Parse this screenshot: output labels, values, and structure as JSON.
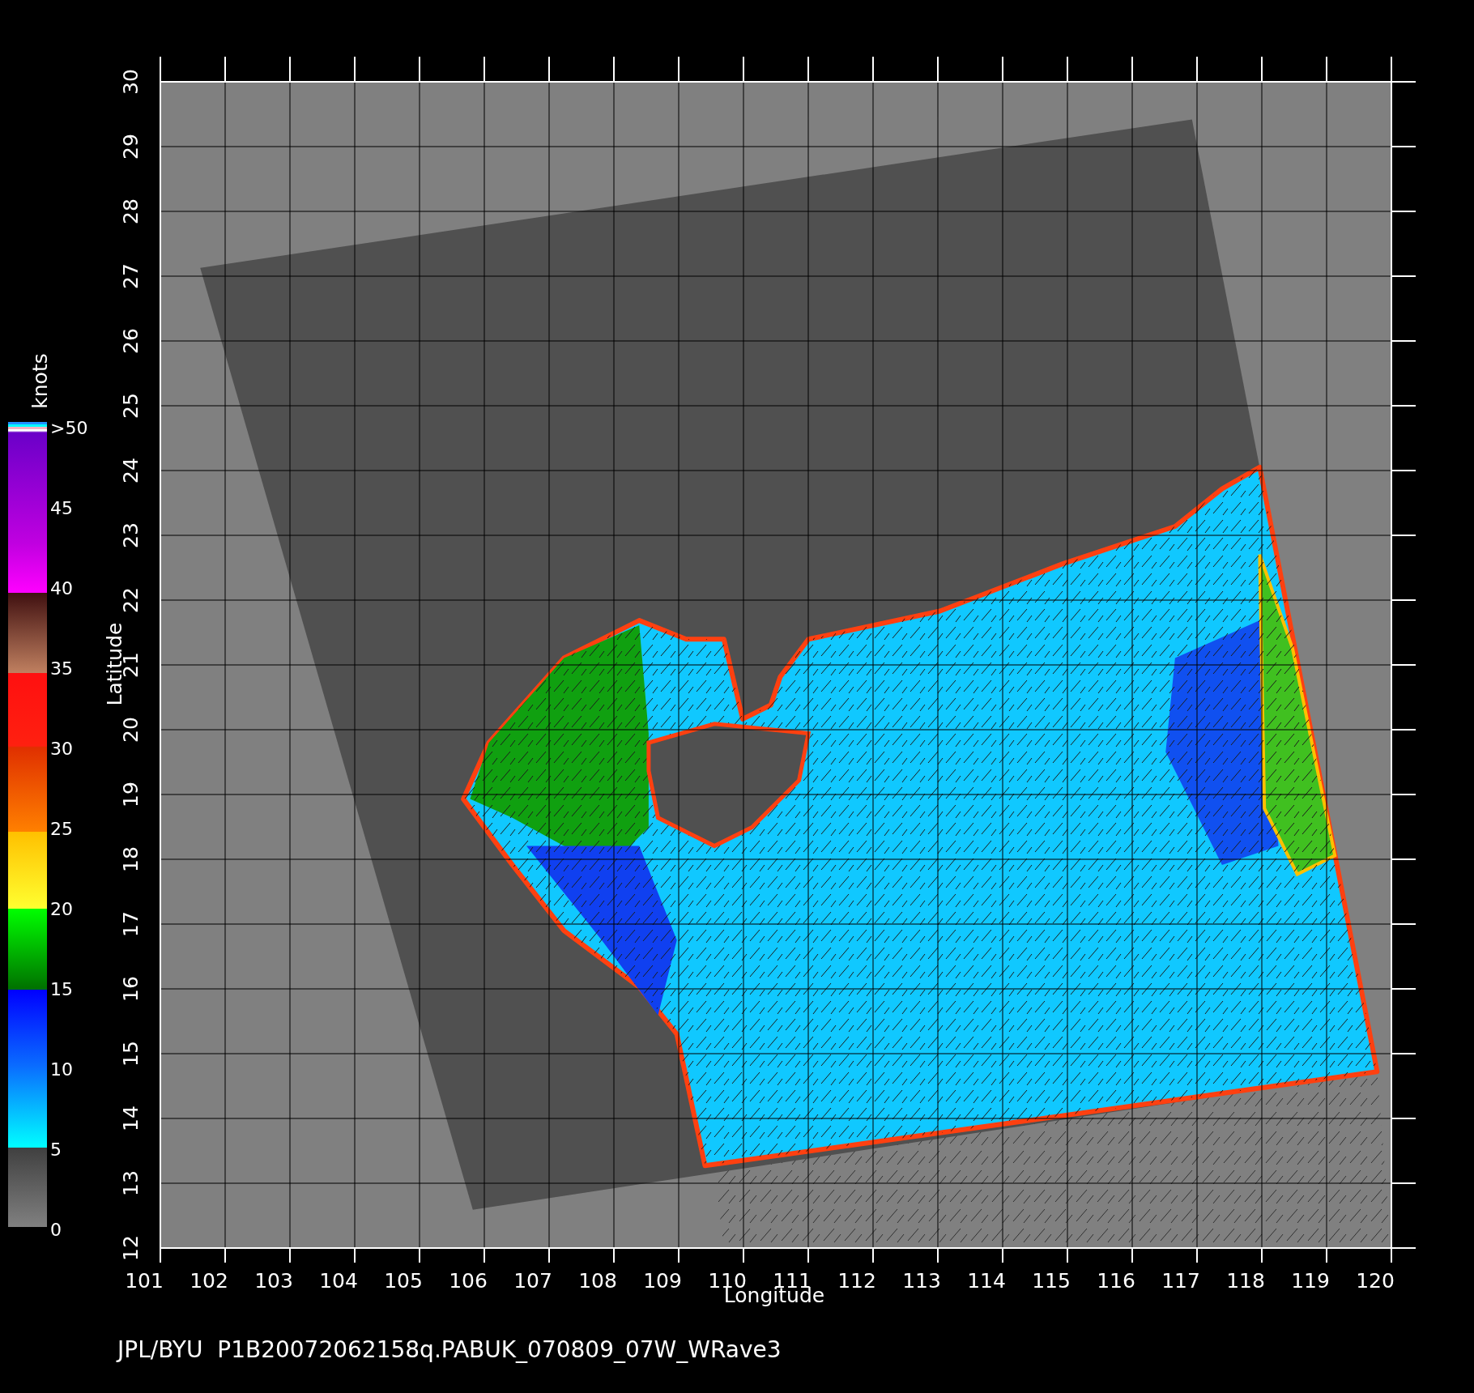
{
  "plot": {
    "x_axis": {
      "title": "Longitude",
      "tick_labels": [
        "101",
        "102",
        "103",
        "104",
        "105",
        "106",
        "107",
        "108",
        "109",
        "110",
        "111",
        "112",
        "113",
        "114",
        "115",
        "116",
        "117",
        "118",
        "119",
        "120"
      ]
    },
    "y_axis": {
      "title": "Latitude",
      "tick_labels": [
        "30",
        "29",
        "28",
        "27",
        "26",
        "25",
        "24",
        "23",
        "22",
        "21",
        "20",
        "19",
        "18",
        "17",
        "16",
        "15",
        "14",
        "13",
        "12"
      ]
    }
  },
  "colorbar": {
    "unit": "knots",
    "labels": [
      ">50",
      "45",
      "40",
      "35",
      "30",
      "25",
      "20",
      "15",
      "10",
      "5",
      "0"
    ]
  },
  "caption": "JPL/BYU  P1B20072062158q.PABUK_070809_07W_WRave3"
}
